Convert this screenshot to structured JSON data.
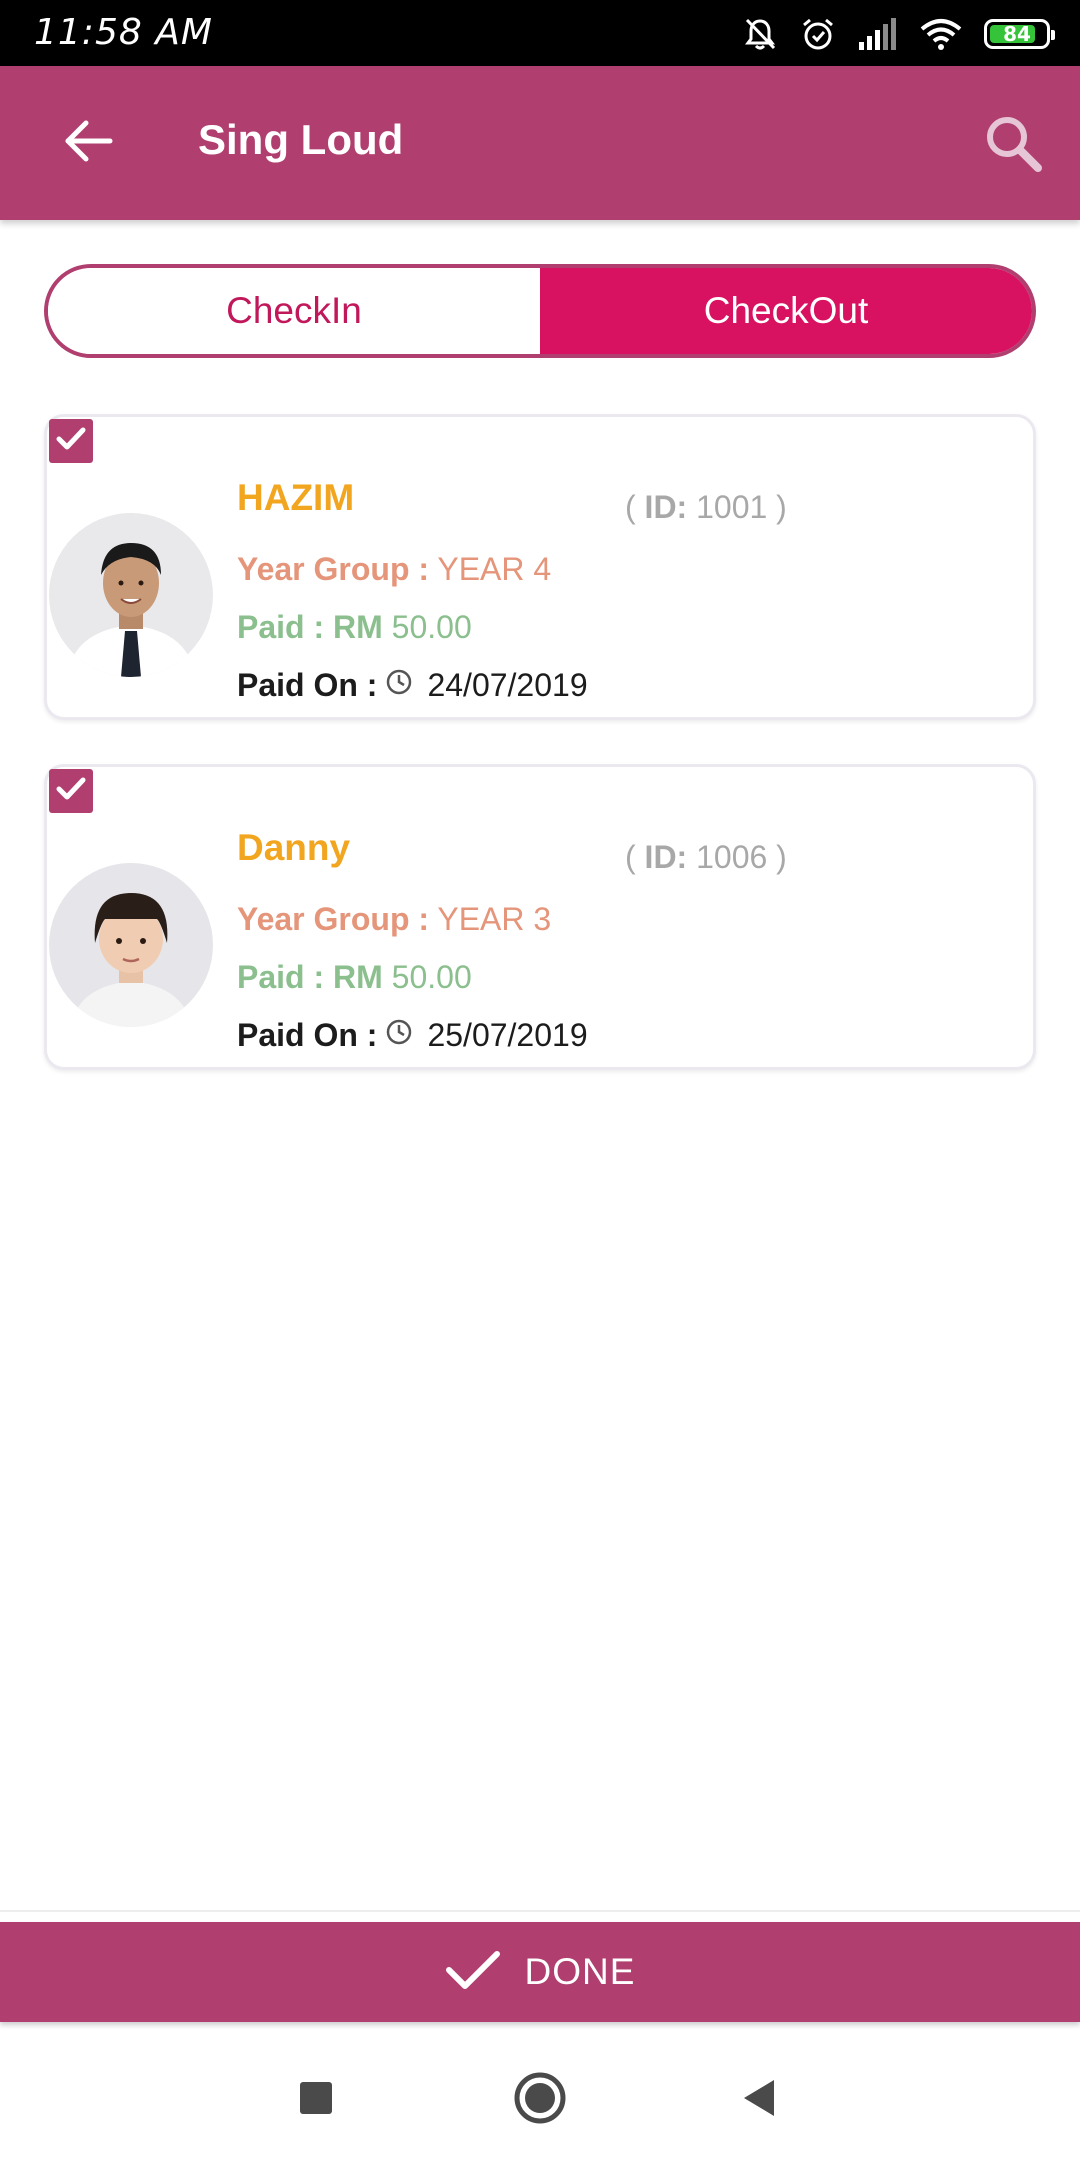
{
  "status_bar": {
    "time": "11:58 AM",
    "battery": "84",
    "icons": [
      "mute-icon",
      "alarm-icon",
      "signal-icon",
      "wifi-icon",
      "battery-icon"
    ]
  },
  "app_bar": {
    "title": "Sing Loud",
    "back_icon": "arrow-left-icon",
    "search_icon": "search-icon"
  },
  "tabs": [
    {
      "label": "CheckIn",
      "selected": false
    },
    {
      "label": "CheckOut",
      "selected": true
    }
  ],
  "students": [
    {
      "name": "HAZIM",
      "id_label": "ID:",
      "id": "1001",
      "year_group_label": "Year Group :",
      "year_group": "YEAR 4",
      "paid_label": "Paid : RM",
      "paid_amount": "50.00",
      "paid_on_label": "Paid On :",
      "paid_on": "24/07/2019",
      "checked": true
    },
    {
      "name": "Danny",
      "id_label": "ID:",
      "id": "1006",
      "year_group_label": "Year Group :",
      "year_group": "YEAR 3",
      "paid_label": "Paid : RM",
      "paid_amount": "50.00",
      "paid_on_label": "Paid On :",
      "paid_on": "25/07/2019",
      "checked": true
    }
  ],
  "done_button": {
    "label": "DONE"
  },
  "colors": {
    "primary": "#b03f70",
    "accent": "#d81160",
    "name": "#f2a51f",
    "year_group": "#e5957a",
    "paid": "#8bbf8e",
    "id": "#a8a8a8"
  }
}
